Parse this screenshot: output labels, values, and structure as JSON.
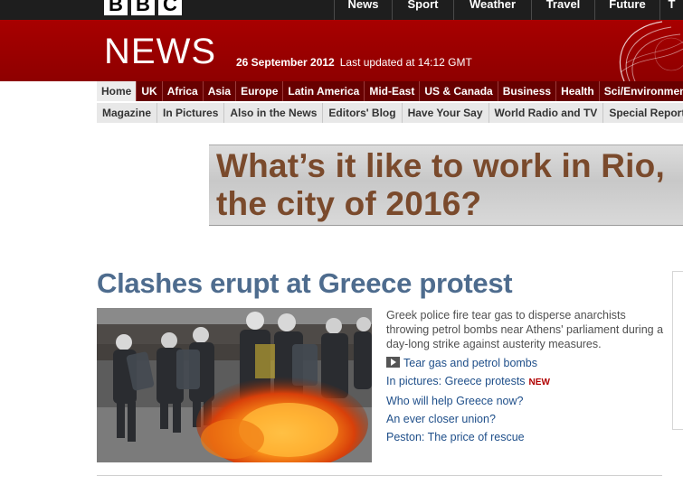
{
  "brand": {
    "letters": [
      "B",
      "B",
      "C"
    ],
    "section": "NEWS"
  },
  "top_nav": [
    "News",
    "Sport",
    "Weather",
    "Travel",
    "Future",
    "T"
  ],
  "masthead": {
    "date": "26 September 2012",
    "updated": "Last updated at 14:12 GMT"
  },
  "primary_nav": [
    "Home",
    "UK",
    "Africa",
    "Asia",
    "Europe",
    "Latin America",
    "Mid-East",
    "US & Canada",
    "Business",
    "Health",
    "Sci/Environment"
  ],
  "secondary_nav": [
    "Magazine",
    "In Pictures",
    "Also in the News",
    "Editors' Blog",
    "Have Your Say",
    "World Radio and TV",
    "Special Reports"
  ],
  "ad": {
    "line1": "What’s it like to work in Rio,",
    "line2": "the city of 2016?"
  },
  "story": {
    "headline": "Clashes erupt at Greece protest",
    "summary": "Greek police fire tear gas to disperse anarchists throwing petrol bombs near Athens' parliament during a day-long strike against austerity measures.",
    "links": [
      {
        "text": "Tear gas and petrol bombs",
        "icon": "video-play-icon"
      },
      {
        "text": "In pictures: Greece protests",
        "badge": "NEW"
      },
      {
        "text": "Who will help Greece now?"
      },
      {
        "text": "An ever closer union?"
      },
      {
        "text": "Peston: The price of rescue"
      }
    ]
  },
  "colors": {
    "bbc_red": "#990000",
    "nav_dark_red": "#680000",
    "headline_blue": "#4e6c8e",
    "link_blue": "#1f4f8a"
  }
}
